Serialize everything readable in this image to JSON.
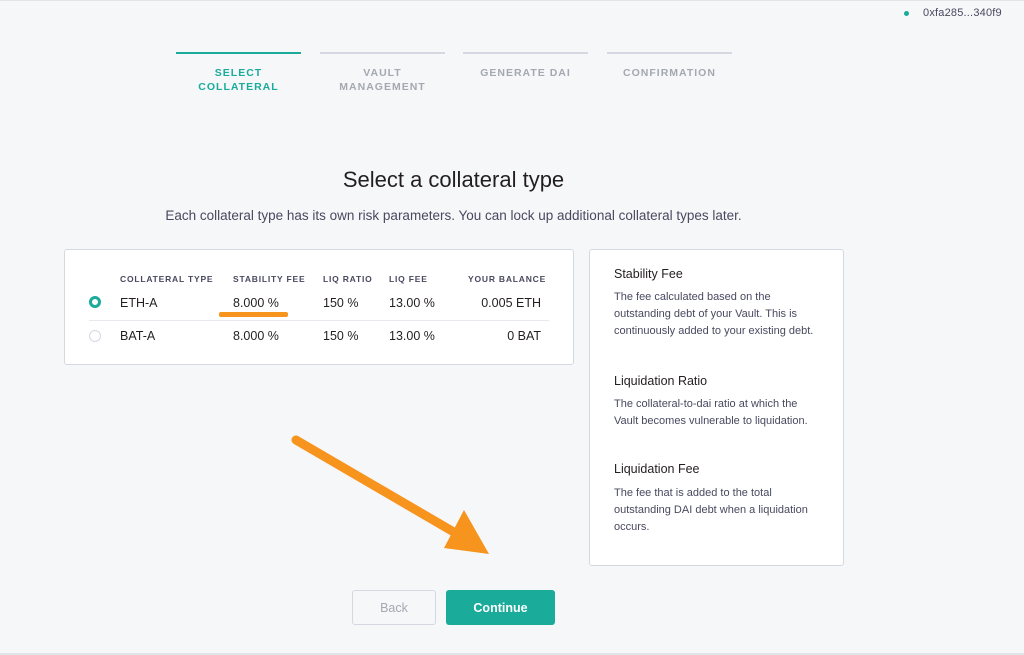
{
  "wallet": {
    "address": "0xfa285...340f9"
  },
  "stepper": {
    "steps": [
      {
        "label": "SELECT COLLATERAL",
        "active": true
      },
      {
        "label": "VAULT MANAGEMENT",
        "active": false
      },
      {
        "label": "GENERATE DAI",
        "active": false
      },
      {
        "label": "CONFIRMATION",
        "active": false
      }
    ]
  },
  "page": {
    "title": "Select a collateral type",
    "subtitle": "Each collateral type has its own risk parameters. You can lock up additional collateral types later."
  },
  "table": {
    "headers": [
      "COLLATERAL TYPE",
      "STABILITY FEE",
      "LIQ RATIO",
      "LIQ FEE",
      "YOUR BALANCE"
    ],
    "rows": [
      {
        "type": "ETH-A",
        "stability_fee": "8.000 %",
        "liq_ratio": "150 %",
        "liq_fee": "13.00 %",
        "balance": "0.005 ETH",
        "selected": true
      },
      {
        "type": "BAT-A",
        "stability_fee": "8.000 %",
        "liq_ratio": "150 %",
        "liq_fee": "13.00 %",
        "balance": "0 BAT",
        "selected": false
      }
    ]
  },
  "info": {
    "stability_fee_title": "Stability Fee",
    "stability_fee_text": "The fee calculated based on the outstanding debt of your Vault. This is continuously added to your existing debt.",
    "liq_ratio_title": "Liquidation Ratio",
    "liq_ratio_text": "The collateral-to-dai ratio at which the Vault becomes vulnerable to liquidation.",
    "liq_fee_title": "Liquidation Fee",
    "liq_fee_text": "The fee that is added to the total outstanding DAI debt when a liquidation occurs."
  },
  "buttons": {
    "back": "Back",
    "continue": "Continue"
  },
  "colors": {
    "accent": "#1aab9b",
    "annotation": "#f7941d",
    "background": "#f6f7f9",
    "border": "#d4d9e1"
  }
}
